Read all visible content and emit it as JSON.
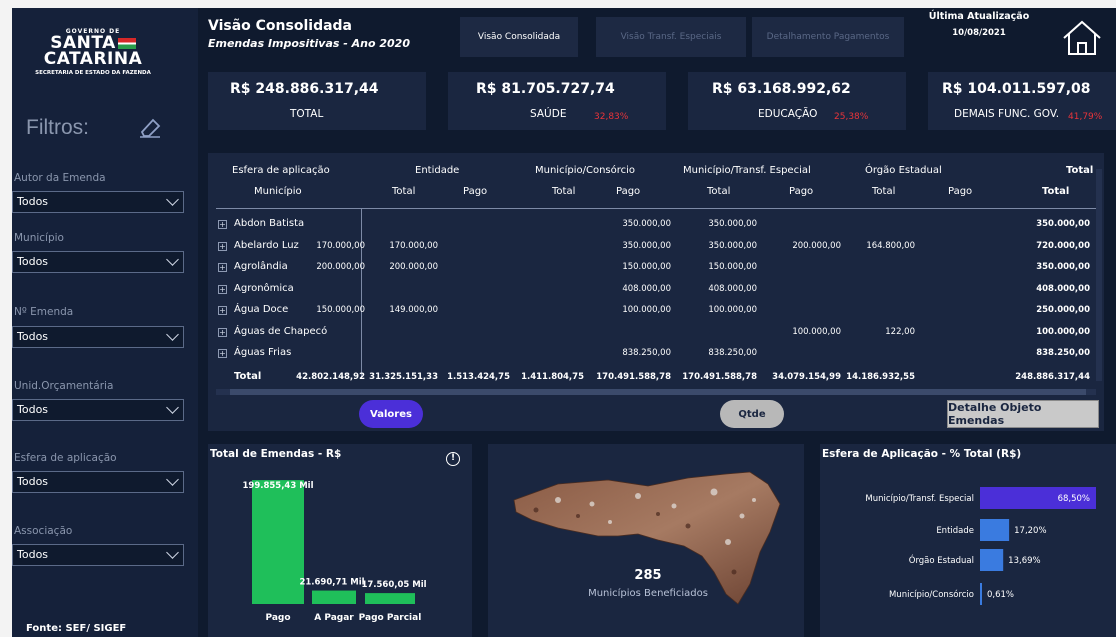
{
  "sidebar": {
    "logo": {
      "gov": "GOVERNO DE",
      "brand_line1": "SANTA",
      "brand_line2": "CATARINA",
      "secretaria": "SECRETARIA DE ESTADO DA FAZENDA"
    },
    "filters_title": "Filtros:",
    "filters": [
      {
        "label": "Autor da Emenda",
        "value": "Todos"
      },
      {
        "label": "Município",
        "value": "Todos"
      },
      {
        "label": "Nº Emenda",
        "value": "Todos"
      },
      {
        "label": "Unid.Orçamentária",
        "value": "Todos"
      },
      {
        "label": "Esfera de aplicação",
        "value": "Todos"
      },
      {
        "label": "Associação",
        "value": "Todos"
      }
    ],
    "source": "Fonte: SEF/ SIGEF"
  },
  "header": {
    "title": "Visão Consolidada",
    "subtitle": "Emendas Impositivas - Ano 2020",
    "tabs": [
      "Visão Consolidada",
      "Visão Transf. Especiais",
      "Detalhamento Pagamentos"
    ],
    "update_label": "Última Atualização",
    "update_date": "10/08/2021"
  },
  "kpis": [
    {
      "value": "R$ 248.886.317,44",
      "label": "TOTAL",
      "pct": ""
    },
    {
      "value": "R$ 81.705.727,74",
      "label": "SAÚDE",
      "pct": "32,83%"
    },
    {
      "value": "R$ 63.168.992,62",
      "label": "EDUCAÇÃO",
      "pct": "25,38%"
    },
    {
      "value": "R$ 104.011.597,08",
      "label": "DEMAIS FUNC. GOV.",
      "pct": "41,79%"
    }
  ],
  "table": {
    "header_row1": [
      "Esfera de aplicação",
      "Entidade",
      "Município/Consórcio",
      "Município/Transf. Especial",
      "Órgão Estadual",
      "Total"
    ],
    "header_row2": [
      "Município",
      "Total",
      "Pago",
      "Total",
      "Pago",
      "Total",
      "Pago",
      "Total",
      "Pago",
      "Total"
    ],
    "rows": [
      {
        "muni": "Abdon Batista",
        "cells": [
          "",
          "",
          "",
          "",
          "350.000,00",
          "350.000,00",
          "",
          "",
          "350.000,00"
        ]
      },
      {
        "muni": "Abelardo Luz",
        "cells": [
          "170.000,00",
          "170.000,00",
          "",
          "",
          "350.000,00",
          "350.000,00",
          "200.000,00",
          "164.800,00",
          "720.000,00"
        ]
      },
      {
        "muni": "Agrolândia",
        "cells": [
          "200.000,00",
          "200.000,00",
          "",
          "",
          "150.000,00",
          "150.000,00",
          "",
          "",
          "350.000,00"
        ]
      },
      {
        "muni": "Agronômica",
        "cells": [
          "",
          "",
          "",
          "",
          "408.000,00",
          "408.000,00",
          "",
          "",
          "408.000,00"
        ]
      },
      {
        "muni": "Água Doce",
        "cells": [
          "150.000,00",
          "149.000,00",
          "",
          "",
          "100.000,00",
          "100.000,00",
          "",
          "",
          "250.000,00"
        ]
      },
      {
        "muni": "Águas de Chapecó",
        "cells": [
          "",
          "",
          "",
          "",
          "",
          "",
          "100.000,00",
          "122,00",
          "100.000,00"
        ]
      },
      {
        "muni": "Águas Frias",
        "cells": [
          "",
          "",
          "",
          "",
          "838.250,00",
          "838.250,00",
          "",
          "",
          "838.250,00"
        ]
      }
    ],
    "total_label": "Total",
    "totals": [
      "42.802.148,92",
      "31.325.151,33",
      "1.513.424,75",
      "1.411.804,75",
      "170.491.588,78",
      "170.491.588,78",
      "34.079.154,99",
      "14.186.932,55",
      "248.886.317,44"
    ]
  },
  "buttons": {
    "valores": "Valores",
    "qtde": "Qtde",
    "detalhe": "Detalhe Objeto Emendas"
  },
  "map": {
    "count": "285",
    "label": "Municípios Beneficiados"
  },
  "colors": {
    "bg": "#0f1a2e",
    "panel": "#1a2640",
    "green": "#1fbf5a",
    "purple": "#4b2fd8",
    "blue": "#3a7be0",
    "red": "#e8343a"
  },
  "chart_data": [
    {
      "type": "bar",
      "title": "Total de Emendas - R$",
      "categories": [
        "Pago",
        "A Pagar",
        "Pago Parcial"
      ],
      "values": [
        199855.43,
        21690.71,
        17560.05
      ],
      "data_labels": [
        "199.855,43 Mil",
        "21.690,71 Mil",
        "17.560,05 Mil"
      ],
      "ylim": [
        0,
        200000
      ]
    },
    {
      "type": "bar",
      "orientation": "horizontal",
      "title": "Esfera de Aplicação - % Total (R$)",
      "categories": [
        "Município/Transf. Especial",
        "Entidade",
        "Órgão Estadual",
        "Município/Consórcio"
      ],
      "values": [
        68.5,
        17.2,
        13.69,
        0.61
      ],
      "data_labels": [
        "68,50%",
        "17,20%",
        "13,69%",
        "0,61%"
      ],
      "xlim": [
        0,
        68.5
      ]
    }
  ]
}
